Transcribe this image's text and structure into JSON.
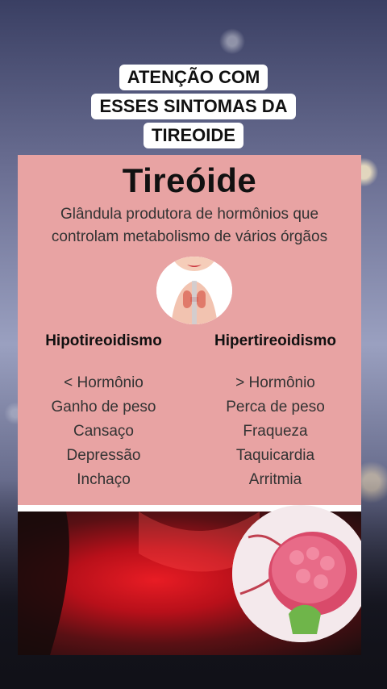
{
  "caption": {
    "line1": "ATENÇÃO COM",
    "line2": "ESSES SINTOMAS DA",
    "line3": "TIREOIDE"
  },
  "card": {
    "title": "Tireóide",
    "subtitle_line1": "Glândula produtora de hormônios que",
    "subtitle_line2": "controlam metabolismo de vários órgãos",
    "left": {
      "heading": "Hipotireoidismo",
      "items": [
        "< Hormônio",
        "Ganho de peso",
        "Cansaço",
        "Depressão",
        "Inchaço"
      ]
    },
    "right": {
      "heading": "Hipertireoidismo",
      "items": [
        "> Hormônio",
        "Perca de peso",
        "Fraqueza",
        "Taquicardia",
        "Arritmia"
      ]
    }
  },
  "colors": {
    "card_background": "#e8a3a3",
    "caption_background": "#ffffff",
    "neck_glow": "#e81c24"
  },
  "icons": {
    "neck_illustration": "thyroid-neck-illustration",
    "gland_zoom": "thyroid-gland-zoom"
  }
}
